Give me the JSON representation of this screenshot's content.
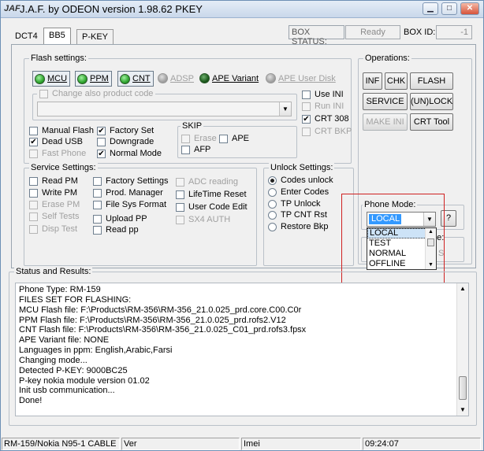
{
  "window": {
    "title": "J.A.F. by ODEON version 1.98.62 PKEY",
    "icon_text": "JAF",
    "controls": {
      "minimize": "▁",
      "maximize": "□",
      "close": "✕"
    }
  },
  "tabs": [
    {
      "label": "DCT4",
      "active": false
    },
    {
      "label": "BB5",
      "active": true
    },
    {
      "label": "P-KEY",
      "active": false
    }
  ],
  "box_status": {
    "label": "BOX STATUS:",
    "value": "Ready",
    "id_label": "BOX ID:",
    "id_value": "-1"
  },
  "flash_settings": {
    "title": "Flash settings:",
    "leds": [
      {
        "label": "MCU",
        "state": "green"
      },
      {
        "label": "PPM",
        "state": "green"
      },
      {
        "label": "CNT",
        "state": "green"
      },
      {
        "label": "ADSP",
        "state": "gray"
      },
      {
        "label": "APE Variant",
        "state": "dark"
      },
      {
        "label": "APE User Disk",
        "state": "gray"
      }
    ],
    "change_product_code": "Change also product code",
    "product_code_value": "",
    "right_checks": [
      {
        "label": "Use INI",
        "checked": false,
        "enabled": true
      },
      {
        "label": "Run INI",
        "checked": false,
        "enabled": false
      },
      {
        "label": "CRT 308",
        "checked": true,
        "enabled": true
      },
      {
        "label": "CRT BKP",
        "checked": false,
        "enabled": false
      }
    ],
    "mode_checks": [
      {
        "label": "Manual Flash",
        "checked": false,
        "enabled": true
      },
      {
        "label": "Factory Set",
        "checked": true,
        "enabled": true
      },
      {
        "label": "Dead USB",
        "checked": true,
        "enabled": true
      },
      {
        "label": "Downgrade",
        "checked": false,
        "enabled": true
      },
      {
        "label": "Fast Phone",
        "checked": false,
        "enabled": false
      },
      {
        "label": "Normal Mode",
        "checked": true,
        "enabled": true
      }
    ],
    "skip": {
      "title": "SKIP",
      "items": [
        {
          "label": "Erase",
          "checked": false,
          "enabled": false
        },
        {
          "label": "APE",
          "checked": false,
          "enabled": true
        },
        {
          "label": "AFP",
          "checked": false,
          "enabled": true
        }
      ]
    }
  },
  "operations": {
    "title": "Operations:",
    "buttons": [
      {
        "label": "INF",
        "enabled": true
      },
      {
        "label": "CHK",
        "enabled": true
      },
      {
        "label": "FLASH",
        "enabled": true
      },
      {
        "label": "SERVICE",
        "enabled": true
      },
      {
        "label": "(UN)LOCK",
        "enabled": true
      },
      {
        "label": "MAKE INI",
        "enabled": false
      },
      {
        "label": "CRT Tool",
        "enabled": true
      }
    ]
  },
  "service_settings": {
    "title": "Service Settings:",
    "items": [
      {
        "label": "Read PM",
        "enabled": true
      },
      {
        "label": "Factory Settings",
        "enabled": true
      },
      {
        "label": "ADC reading",
        "enabled": false
      },
      {
        "label": "Write PM",
        "enabled": true
      },
      {
        "label": "Prod. Manager",
        "enabled": true
      },
      {
        "label": "LifeTime Reset",
        "enabled": true
      },
      {
        "label": "Erase PM",
        "enabled": false
      },
      {
        "label": "File Sys Format",
        "enabled": true
      },
      {
        "label": "User Code Edit",
        "enabled": true
      },
      {
        "label": "Self Tests",
        "enabled": false
      },
      {
        "label": "Upload PP",
        "enabled": true
      },
      {
        "label": "SX4 AUTH",
        "enabled": false
      },
      {
        "label": "Disp Test",
        "enabled": false
      },
      {
        "label": "Read pp",
        "enabled": true
      }
    ]
  },
  "unlock_settings": {
    "title": "Unlock Settings:",
    "options": [
      {
        "label": "Codes unlock",
        "selected": true
      },
      {
        "label": "Enter Codes",
        "selected": false
      },
      {
        "label": "TP Unlock",
        "selected": false
      },
      {
        "label": "TP CNT Rst",
        "selected": false
      },
      {
        "label": "Restore Bkp",
        "selected": false
      }
    ]
  },
  "phone_mode": {
    "title": "Phone Mode:",
    "selected": "LOCAL",
    "help_label": "?",
    "options": [
      "LOCAL",
      "TEST",
      "NORMAL",
      "OFFLINE"
    ],
    "hidden_fragment_1": "de:",
    "hidden_fragment_2": "S"
  },
  "status": {
    "title": "Status and Results:",
    "lines": [
      "Phone Type: RM-159",
      "FILES SET FOR FLASHING:",
      "MCU Flash file: F:\\Products\\RM-356\\RM-356_21.0.025_prd.core.C00.C0r",
      "PPM Flash file: F:\\Products\\RM-356\\RM-356_21.0.025_prd.rofs2.V12",
      "CNT Flash file: F:\\Products\\RM-356\\RM-356_21.0.025_C01_prd.rofs3.fpsx",
      "APE Variant file: NONE",
      "Languages in ppm: English,Arabic,Farsi",
      "Changing mode...",
      "Detected P-KEY: 9000BC25",
      "P-key nokia module version 01.02",
      "Init usb communication...",
      "Done!"
    ]
  },
  "statusbar": {
    "phone": "RM-159/Nokia N95-1 CABLE",
    "ver": "Ver",
    "imei": "Imei",
    "time": "09:24:07"
  }
}
